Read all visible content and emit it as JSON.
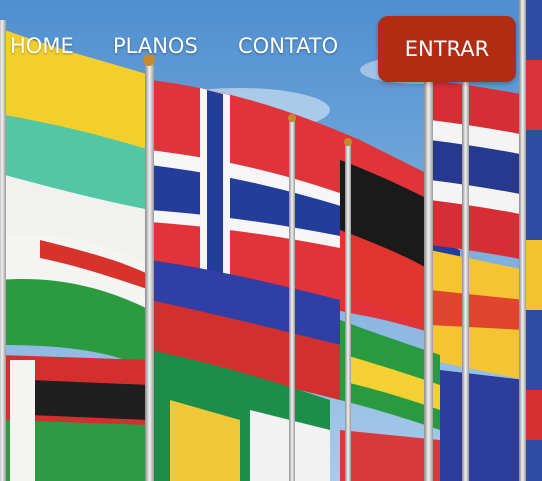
{
  "nav": {
    "items": [
      {
        "label": "HOME"
      },
      {
        "label": "PLANOS"
      },
      {
        "label": "CONTATO"
      }
    ],
    "cta_label": "ENTRAR"
  },
  "colors": {
    "cta_background": "#b22c14",
    "nav_text": "#ffffff",
    "sky": "#6fa7d8"
  },
  "hero": {
    "image_description_icon": "flags-photo-icon"
  }
}
